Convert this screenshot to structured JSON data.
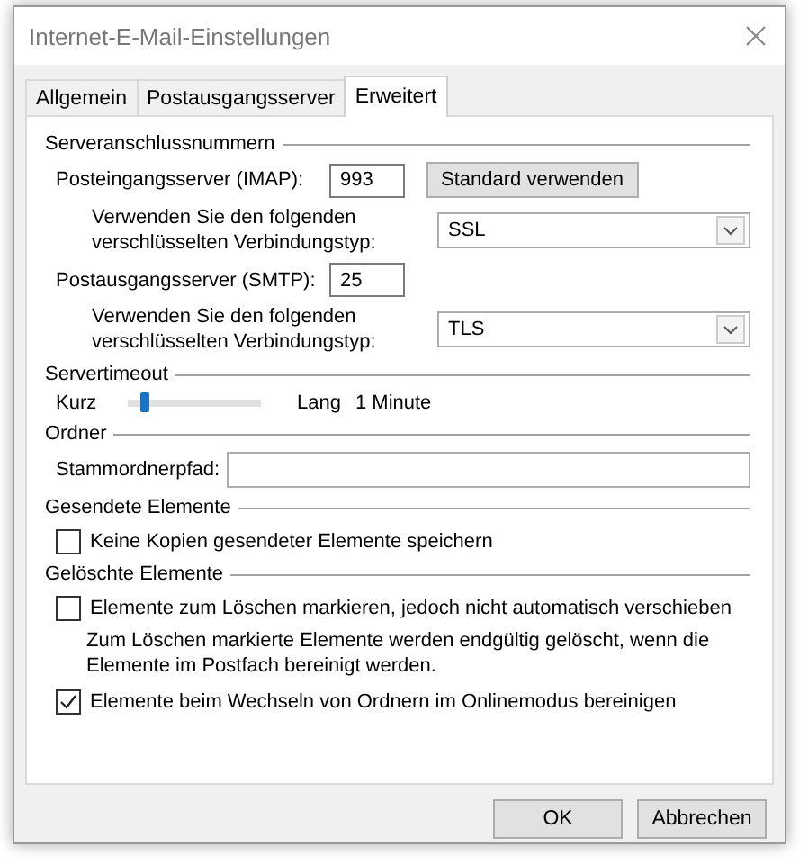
{
  "window": {
    "title": "Internet-E-Mail-Einstellungen"
  },
  "tabs": [
    {
      "label": "Allgemein",
      "selected": false
    },
    {
      "label": "Postausgangsserver",
      "selected": false
    },
    {
      "label": "Erweitert",
      "selected": true
    }
  ],
  "sections": [
    {
      "title": "Serveranschlussnummern",
      "rows": [
        {
          "kind": "port",
          "label": "Posteingangsserver (IMAP):",
          "value": "993",
          "button": "Standard verwenden"
        },
        {
          "kind": "select",
          "label": "Verwenden Sie den folgenden verschlüsselten Verbindungstyp:",
          "value": "SSL"
        },
        {
          "kind": "port",
          "label": "Postausgangsserver (SMTP):",
          "value": "25"
        },
        {
          "kind": "select",
          "label": "Verwenden Sie den folgenden verschlüsselten Verbindungstyp:",
          "value": "TLS"
        }
      ]
    },
    {
      "title": "Servertimeout",
      "rows": [
        {
          "kind": "slider",
          "min_label": "Kurz",
          "max_label": "Lang",
          "level": 0.1,
          "reading": "1 Minute"
        }
      ]
    },
    {
      "title": "Ordner",
      "rows": [
        {
          "kind": "text",
          "label": "Stammordnerpfad:"
        }
      ]
    },
    {
      "title": "Gesendete Elemente",
      "rows": [
        {
          "kind": "checkbox",
          "label": "Keine Kopien gesendeter Elemente speichern",
          "checked": false
        }
      ]
    },
    {
      "title": "Gelöschte Elemente",
      "rows": [
        {
          "kind": "checkbox",
          "label": "Elemente zum Löschen markieren, jedoch nicht automatisch verschieben",
          "checked": false
        },
        {
          "kind": "note",
          "text": "Zum Löschen markierte Elemente werden endgültig gelöscht, wenn die Elemente im Postfach bereinigt werden."
        },
        {
          "kind": "checkbox",
          "label": "Elemente beim Wechseln von Ordnern im Onlinemodus bereinigen",
          "checked": true
        }
      ]
    }
  ],
  "buttons": [
    {
      "label": "OK"
    },
    {
      "label": "Abbrechen"
    }
  ]
}
